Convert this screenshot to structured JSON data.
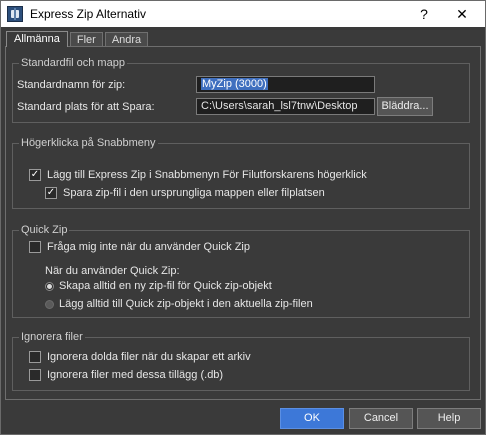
{
  "window": {
    "title": "Express Zip Alternativ",
    "help_glyph": "?",
    "close_glyph": "✕"
  },
  "tabs": [
    {
      "label": "Allmänna",
      "active": true
    },
    {
      "label": "Fler",
      "active": false
    },
    {
      "label": "Andra",
      "active": false
    }
  ],
  "standard": {
    "title": "Standardfil och mapp",
    "name_label": "Standardnamn för zip:",
    "name_value": "MyZip (3000)",
    "location_label": "Standard plats för att Spara:",
    "location_value": "C:\\Users\\sarah_lsl7tnw\\Desktop",
    "browse_label": "Bläddra..."
  },
  "context_menu": {
    "title": "Högerklicka på Snabbmeny",
    "add_to_menu_label": "Lägg till Express Zip i Snabbmenyn För Filutforskarens högerklick",
    "add_to_menu_checked": true,
    "save_in_original_label": "Spara zip-fil i den ursprungliga mappen eller filplatsen",
    "save_in_original_checked": true
  },
  "quick_zip": {
    "title": "Quick Zip",
    "dont_ask_label": "Fråga mig inte när du använder Quick Zip",
    "dont_ask_checked": false,
    "when_using_label": "När du använder Quick Zip:",
    "option_new_label": "Skapa alltid en ny zip-fil för Quick zip-objekt",
    "option_current_label": "Lägg alltid till Quick zip-objekt i den aktuella zip-filen",
    "selected_option": "new"
  },
  "ignore": {
    "title": "Ignorera filer",
    "hidden_label": "Ignorera dolda filer när du skapar ett arkiv",
    "hidden_checked": false,
    "extensions_label": "Ignorera filer med dessa tillägg (.db)",
    "extensions_checked": false
  },
  "footer": {
    "ok_label": "OK",
    "cancel_label": "Cancel",
    "help_label": "Help"
  },
  "colors": {
    "accent": "#3d78d8",
    "background": "#3a3a3a",
    "selection": "#3f6fbf"
  }
}
